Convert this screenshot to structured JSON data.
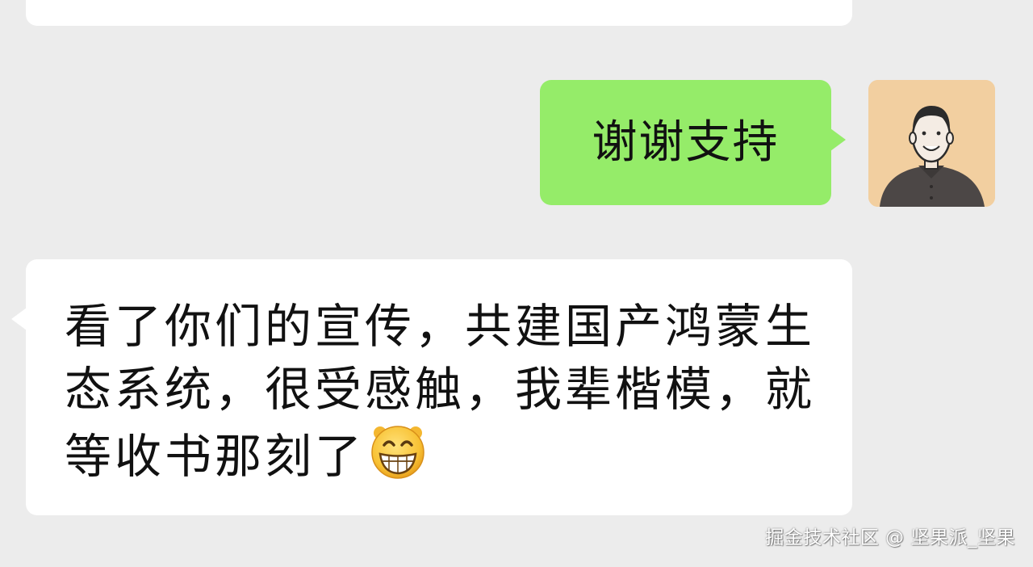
{
  "chat": {
    "messages": [
      {
        "sender": "self",
        "text": "谢谢支持"
      },
      {
        "sender": "other",
        "text": "看了你们的宣传，共建国产鸿蒙生态系统，很受感触，我辈楷模，就等收书那刻了",
        "emoji": "grinning-face-icon"
      }
    ]
  },
  "watermark": {
    "text": "掘金技术社区 @ 坚果派_坚果"
  },
  "colors": {
    "background": "#ececec",
    "sent_bubble": "#95ec69",
    "received_bubble": "#ffffff",
    "avatar_bg": "#f2cfa0"
  }
}
